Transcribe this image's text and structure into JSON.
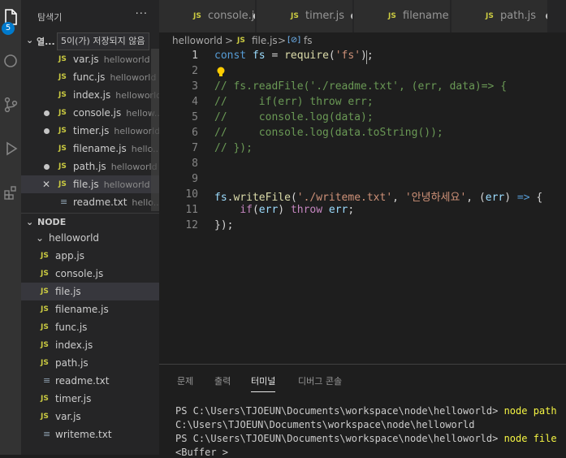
{
  "activity_bar": {
    "explorer_badge": "5"
  },
  "sidebar": {
    "title": "탐색기",
    "more": "···",
    "open_editors_label": "열...",
    "tooltip": "5이(가) 저장되지 않음",
    "open_editors": [
      {
        "name": "var.js",
        "dir": "helloworld",
        "state": "none",
        "type": "js"
      },
      {
        "name": "func.js",
        "dir": "helloworld",
        "state": "none",
        "type": "js"
      },
      {
        "name": "index.js",
        "dir": "helloworld",
        "state": "none",
        "type": "js"
      },
      {
        "name": "console.js",
        "dir": "hellow...",
        "state": "dirty",
        "type": "js"
      },
      {
        "name": "timer.js",
        "dir": "helloworld",
        "state": "dirty",
        "type": "js"
      },
      {
        "name": "filename.js",
        "dir": "hello...",
        "state": "none",
        "type": "js"
      },
      {
        "name": "path.js",
        "dir": "helloworld",
        "state": "dirty",
        "type": "js"
      },
      {
        "name": "file.js",
        "dir": "helloworld",
        "state": "close",
        "type": "js",
        "selected": true
      },
      {
        "name": "readme.txt",
        "dir": "hello...",
        "state": "none",
        "type": "txt"
      }
    ],
    "node_section_label": "NODE",
    "folder": "helloworld",
    "files": [
      {
        "name": "app.js",
        "type": "js"
      },
      {
        "name": "console.js",
        "type": "js"
      },
      {
        "name": "file.js",
        "type": "js",
        "selected": true
      },
      {
        "name": "filename.js",
        "type": "js"
      },
      {
        "name": "func.js",
        "type": "js"
      },
      {
        "name": "index.js",
        "type": "js"
      },
      {
        "name": "path.js",
        "type": "js"
      },
      {
        "name": "readme.txt",
        "type": "txt"
      },
      {
        "name": "timer.js",
        "type": "js"
      },
      {
        "name": "var.js",
        "type": "js"
      },
      {
        "name": "writeme.txt",
        "type": "txt"
      }
    ]
  },
  "tabs": [
    {
      "name": "console.js",
      "dirty": true
    },
    {
      "name": "timer.js",
      "dirty": true
    },
    {
      "name": "filename.js",
      "dirty": false
    },
    {
      "name": "path.js",
      "dirty": true
    }
  ],
  "breadcrumb": {
    "folder": "helloworld",
    "sep": ">",
    "file_icon": "JS",
    "file": "file.js",
    "symbol_icon": "[⊘]",
    "symbol": "fs"
  },
  "editor": {
    "active_line": 1,
    "lines": [
      {
        "n": "1",
        "tokens": [
          [
            "kw",
            "const "
          ],
          [
            "var",
            "fs"
          ],
          [
            "pl",
            " = "
          ],
          [
            "fn",
            "require"
          ],
          [
            "pl",
            "("
          ],
          [
            "str",
            "'fs'"
          ],
          [
            "pl",
            ");"
          ]
        ]
      },
      {
        "n": "2",
        "tokens": [],
        "lightbulb": true
      },
      {
        "n": "3",
        "tokens": [
          [
            "cm",
            "// fs.readFile('./readme.txt', (err, data)=> {"
          ]
        ]
      },
      {
        "n": "4",
        "tokens": [
          [
            "cm",
            "//     if(err) throw err;"
          ]
        ]
      },
      {
        "n": "5",
        "tokens": [
          [
            "cm",
            "//     console.log(data);"
          ]
        ]
      },
      {
        "n": "6",
        "tokens": [
          [
            "cm",
            "//     console.log(data.toString());"
          ]
        ]
      },
      {
        "n": "7",
        "tokens": [
          [
            "cm",
            "// });"
          ]
        ]
      },
      {
        "n": "8",
        "tokens": []
      },
      {
        "n": "9",
        "tokens": []
      },
      {
        "n": "10",
        "tokens": [
          [
            "var",
            "fs"
          ],
          [
            "pl",
            "."
          ],
          [
            "fn",
            "writeFile"
          ],
          [
            "pl",
            "("
          ],
          [
            "str",
            "'./writeme.txt'"
          ],
          [
            "pl",
            ", "
          ],
          [
            "str",
            "'안녕하세요'"
          ],
          [
            "pl",
            ", ("
          ],
          [
            "var",
            "err"
          ],
          [
            "pl",
            ") "
          ],
          [
            "arrow",
            "=>"
          ],
          [
            "pl",
            " {"
          ]
        ]
      },
      {
        "n": "11",
        "tokens": [
          [
            "pl",
            "    "
          ],
          [
            "cf",
            "if"
          ],
          [
            "pl",
            "("
          ],
          [
            "var",
            "err"
          ],
          [
            "pl",
            ") "
          ],
          [
            "cf",
            "throw"
          ],
          [
            "pl",
            " "
          ],
          [
            "var",
            "err"
          ],
          [
            "pl",
            ";"
          ]
        ]
      },
      {
        "n": "12",
        "tokens": [
          [
            "pl",
            "});"
          ]
        ]
      }
    ]
  },
  "panel": {
    "tabs": [
      {
        "label": "문제",
        "active": false
      },
      {
        "label": "출력",
        "active": false
      },
      {
        "label": "터미널",
        "active": true
      },
      {
        "label": "디버그 콘솔",
        "active": false
      }
    ],
    "terminal": [
      {
        "prompt": "PS C:\\Users\\TJOEUN\\Documents\\workspace\\node\\helloworld> ",
        "cmd": "node path"
      },
      {
        "prompt": "C:\\Users\\TJOEUN\\Documents\\workspace\\node\\helloworld",
        "cmd": ""
      },
      {
        "prompt": "PS C:\\Users\\TJOEUN\\Documents\\workspace\\node\\helloworld> ",
        "cmd": "node file"
      },
      {
        "prompt": "<Buffer >",
        "cmd": ""
      }
    ]
  },
  "colors": {
    "accent": "#007acc",
    "js_icon": "#cbcb41",
    "comment": "#6a9955",
    "string": "#ce9178",
    "keyword": "#569cd6"
  }
}
